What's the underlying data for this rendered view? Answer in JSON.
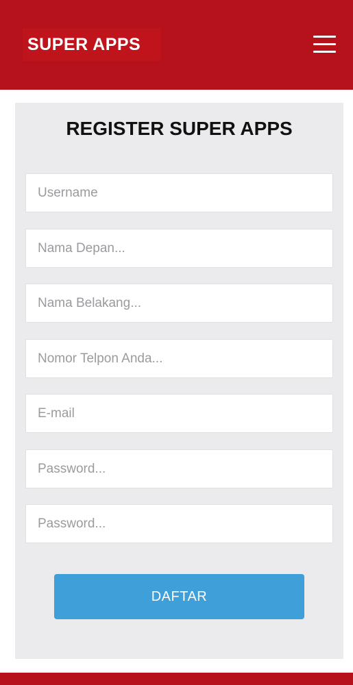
{
  "header": {
    "logo_text": "SUPER APPS",
    "menu_icon": "hamburger-menu-icon"
  },
  "form": {
    "title": "REGISTER SUPER APPS",
    "fields": [
      {
        "placeholder": "Username",
        "value": ""
      },
      {
        "placeholder": "Nama Depan...",
        "value": ""
      },
      {
        "placeholder": "Nama Belakang...",
        "value": ""
      },
      {
        "placeholder": "Nomor Telpon Anda...",
        "value": ""
      },
      {
        "placeholder": "E-mail",
        "value": ""
      },
      {
        "placeholder": "Password...",
        "value": ""
      },
      {
        "placeholder": "Password...",
        "value": ""
      }
    ],
    "submit_label": "DAFTAR"
  },
  "colors": {
    "brand_red": "#b5121b",
    "card_bg": "#ebebed",
    "button_blue": "#3e9fd9"
  }
}
